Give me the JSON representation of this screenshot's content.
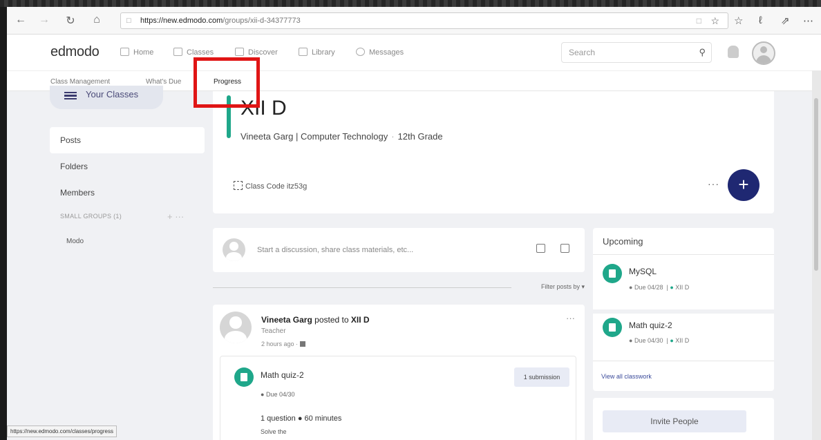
{
  "browser": {
    "url_host": "https://new.edmodo.com",
    "url_path": "/groups/xii-d-34377773"
  },
  "app": {
    "logo": "edmodo",
    "nav": [
      "Home",
      "Classes",
      "Discover",
      "Library",
      "Messages"
    ],
    "search_placeholder": "Search"
  },
  "subnav": {
    "items": [
      "Class Management",
      "What's Due",
      "Progress"
    ],
    "active": "Progress"
  },
  "sidebar": {
    "your_classes": "Your Classes",
    "items": [
      "Posts",
      "Folders",
      "Members"
    ],
    "selected": "Posts",
    "small_groups_label": "SMALL GROUPS (1)",
    "small_groups_controls": "+ ···",
    "groups": [
      "Modo"
    ]
  },
  "class": {
    "name": "XII D",
    "teacher": "Vineeta Garg | Computer Technology",
    "grade": "12th Grade",
    "code_label": "Class Code itz53g",
    "more": "···",
    "add": "+"
  },
  "composer": {
    "placeholder": "Start a discussion, share class materials, etc..."
  },
  "filter": {
    "label": "Filter posts by ▾"
  },
  "post": {
    "author": "Vineeta Garg",
    "action": " posted to ",
    "target": "XII D",
    "role": "Teacher",
    "time": "2 hours ago ·",
    "more": "···",
    "assignment": {
      "title": "Math quiz-2",
      "submission_badge": "1 submission",
      "due": "Due 04/30",
      "meta": "1 question ● 60 minutes",
      "desc": "Solve the"
    }
  },
  "upcoming": {
    "header": "Upcoming",
    "items": [
      {
        "name": "MySQL",
        "due": "Due 04/28",
        "class": "XII D"
      },
      {
        "name": "Math quiz-2",
        "due": "Due 04/30",
        "class": "XII D"
      }
    ],
    "view_all": "View all classwork"
  },
  "invite": "Invite People",
  "status_url": "https://new.edmodo.com/classes/progress",
  "colors": {
    "brand_green": "#1fa78a",
    "brand_navy": "#1f2872",
    "highlight_red": "#e01515"
  }
}
